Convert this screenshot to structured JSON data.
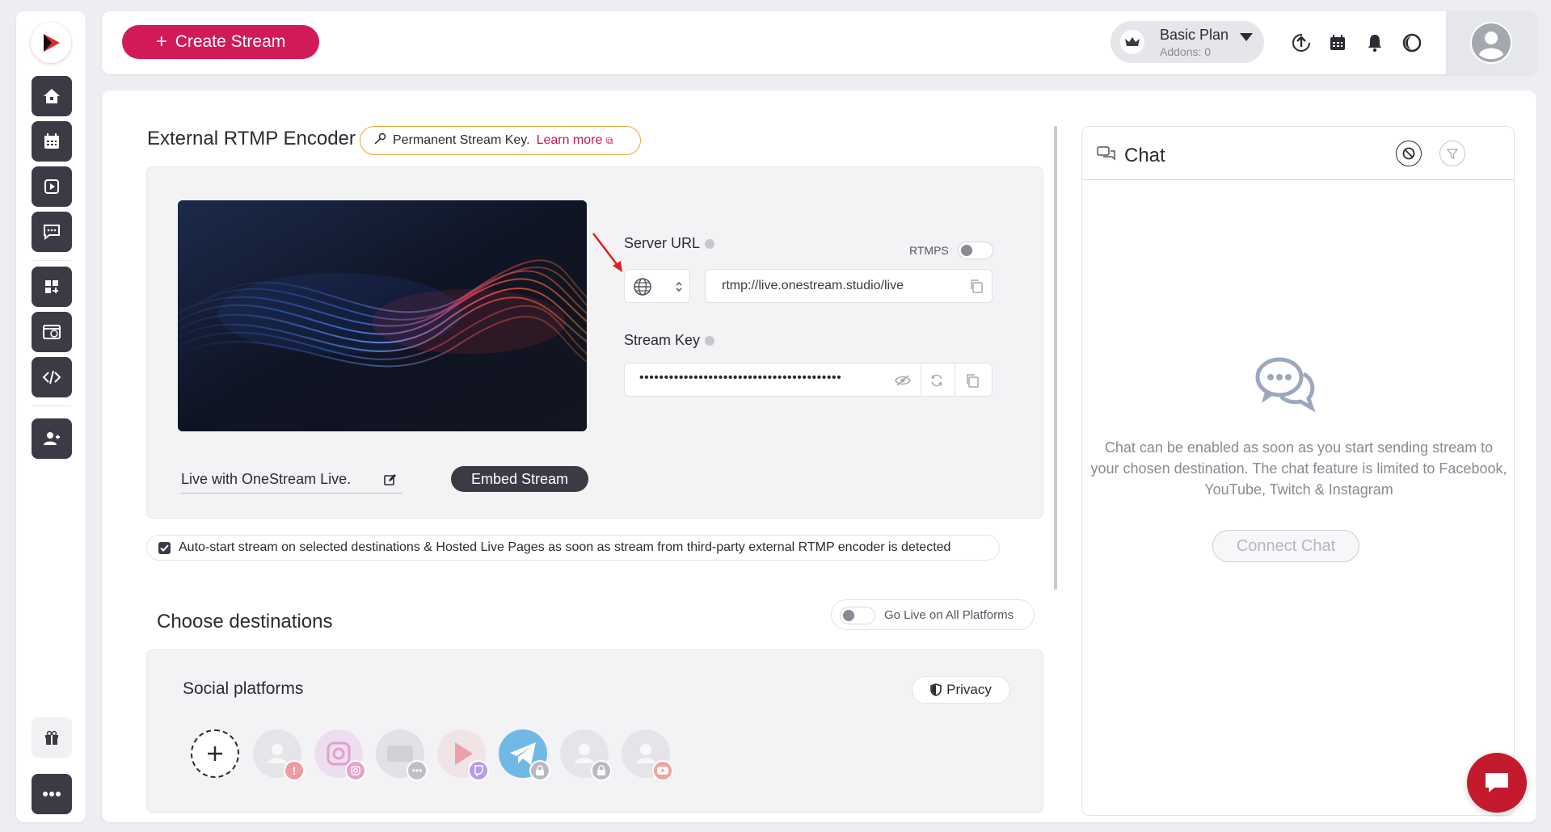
{
  "topbar": {
    "create_stream_label": "Create Stream",
    "plan_name": "Basic Plan",
    "plan_addons": "Addons: 0"
  },
  "encoder": {
    "title": "External RTMP Encoder",
    "permanent_key_text": "Permanent Stream Key.",
    "learn_more": "Learn more",
    "server_url_label": "Server URL",
    "rtmps_label": "RTMPS",
    "server_url_value": "rtmp://live.onestream.studio/live",
    "stream_key_label": "Stream Key",
    "stream_key_value": "•••••••••••••••••••••••••••••••••••••••••",
    "stream_title": "Live with OneStream Live.",
    "embed_label": "Embed Stream"
  },
  "autostart": {
    "label": "Auto-start stream on selected destinations & Hosted Live Pages as soon as stream from third-party external RTMP encoder is detected",
    "checked": true
  },
  "destinations": {
    "title": "Choose destinations",
    "go_live_all_label": "Go Live on All Platforms",
    "social_title": "Social platforms",
    "privacy_label": "Privacy",
    "platforms": [
      {
        "name": "facebook",
        "badge": "!"
      },
      {
        "name": "instagram",
        "badge": "instagram"
      },
      {
        "name": "rtmp",
        "badge": "more"
      },
      {
        "name": "twitch",
        "badge": "twitch"
      },
      {
        "name": "telegram",
        "badge": "lock"
      },
      {
        "name": "locked-account",
        "badge": "lock"
      },
      {
        "name": "youtube",
        "badge": "youtube"
      }
    ]
  },
  "chat": {
    "title": "Chat",
    "message": "Chat can be enabled as soon as you start sending stream to your chosen destination. The chat feature is limited to Facebook, YouTube, Twitch & Instagram",
    "connect_label": "Connect Chat"
  },
  "colors": {
    "brand": "#d21b56",
    "dark": "#3a3b45",
    "fab": "#c41a2d"
  }
}
